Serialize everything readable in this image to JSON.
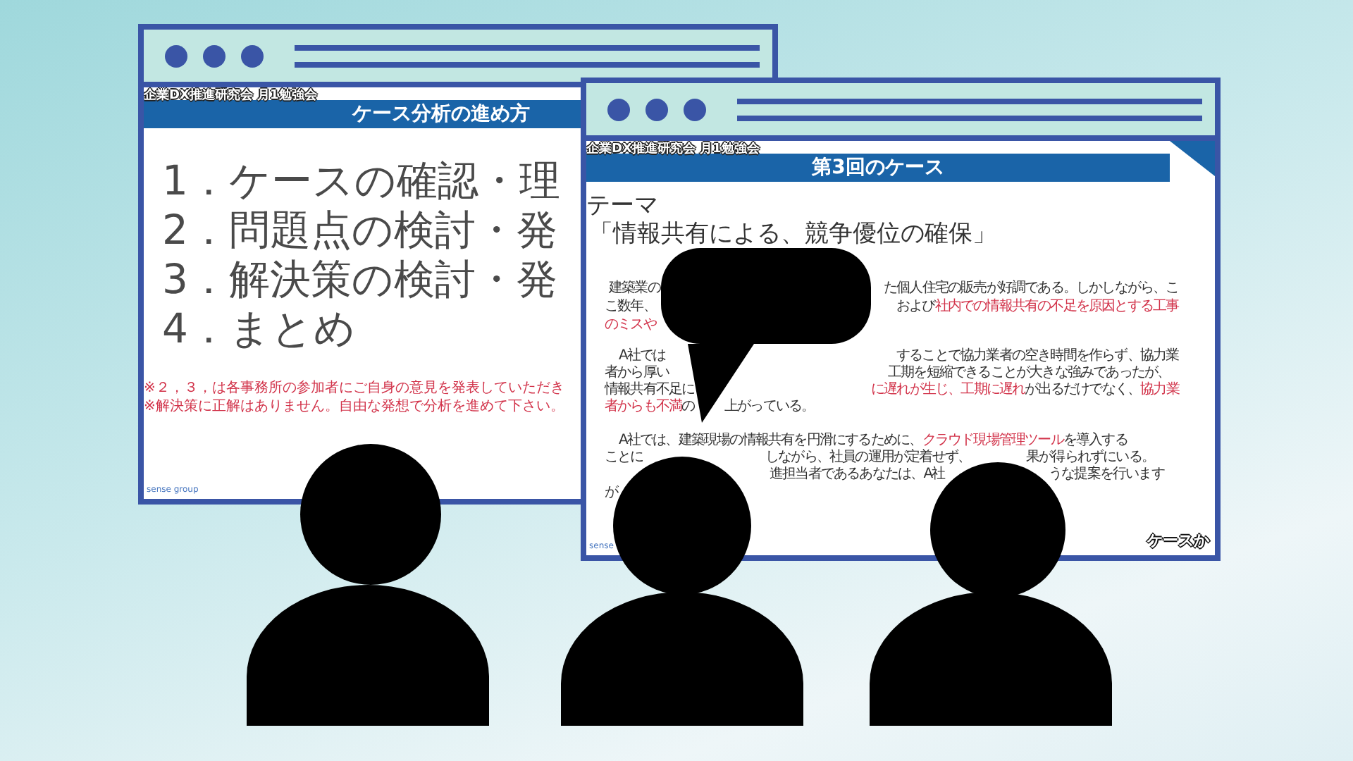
{
  "windows": [
    {
      "kind": "agenda",
      "header": "企業DX推進研究会 月1勉強会",
      "title": "ケース分析の進め方",
      "steps": [
        "1．ケースの確認・理",
        "2．問題点の検討・発",
        "3．解決策の検討・発",
        "4．まとめ"
      ],
      "notes": [
        "※２，３，は各事務所の参加者にご自身の意見を発表していただき",
        "※解決策に正解はありません。自由な発想で分析を進めて下さい。"
      ],
      "footer": "sense group"
    },
    {
      "kind": "case",
      "header": "企業DX推進研究会 月1勉強会",
      "title": "第3回のケース",
      "theme_label": "テーマ",
      "theme": "「情報共有による、競争優位の確保」",
      "lines": [
        {
          "fragments": [
            [
              {
                "text": "建築業の",
                "emphasis": false
              }
            ],
            [
              {
                "text": "た個人住宅の販売が好調である。しかしながら、こ",
                "emphasis": false
              }
            ]
          ]
        },
        {
          "fragments": [
            [
              {
                "text": "こ数年、",
                "emphasis": false
              }
            ],
            [
              {
                "text": "および",
                "emphasis": false
              },
              {
                "text": "社内での情報共有の不足を原因とする工事",
                "emphasis": true
              }
            ]
          ]
        },
        {
          "fragments": [
            [
              {
                "text": "のミスや",
                "emphasis": true
              }
            ]
          ]
        },
        {
          "fragments": [
            [
              {
                "text": "A社では",
                "emphasis": false
              }
            ],
            [
              {
                "text": "することで協力業者の空き時間を作らず、協力業",
                "emphasis": false
              }
            ]
          ]
        },
        {
          "fragments": [
            [
              {
                "text": "者から厚い",
                "emphasis": false
              }
            ],
            [
              {
                "text": "工期を短縮できることが大きな強みであったが、",
                "emphasis": false
              }
            ]
          ]
        },
        {
          "fragments": [
            [
              {
                "text": "情報共有不足に",
                "emphasis": false
              }
            ],
            [
              {
                "text": "に遅れが生じ、工期に遅れ",
                "emphasis": true
              },
              {
                "text": "が出るだけでなく、",
                "emphasis": false
              },
              {
                "text": "協力業",
                "emphasis": true
              }
            ]
          ]
        },
        {
          "fragments": [
            [
              {
                "text": "者からも不満",
                "emphasis": true
              },
              {
                "text": "の",
                "emphasis": false
              }
            ],
            [
              {
                "text": "上がっている。",
                "emphasis": false
              }
            ]
          ]
        },
        {
          "fragments": [
            [
              {
                "text": "A社では、建築現場の情報共有を円滑にするために、",
                "emphasis": false
              },
              {
                "text": "クラウド現場管理ツール",
                "emphasis": true
              },
              {
                "text": "を導入する",
                "emphasis": false
              }
            ]
          ]
        },
        {
          "fragments": [
            [
              {
                "text": "ことに",
                "emphasis": false
              }
            ],
            [
              {
                "text": "しながら、社員の運用が定着せず、",
                "emphasis": false
              }
            ],
            [
              {
                "text": "果が得られずにいる。",
                "emphasis": false
              }
            ]
          ]
        },
        {
          "fragments": [
            [
              {
                "text": "進担当者であるあなたは、A社",
                "emphasis": false
              }
            ],
            [
              {
                "text": "うな提案を行います",
                "emphasis": false
              }
            ]
          ]
        },
        {
          "fragments": [
            [
              {
                "text": "が",
                "emphasis": false
              }
            ]
          ]
        }
      ],
      "footer": "sense",
      "caption": "ケースか"
    }
  ]
}
